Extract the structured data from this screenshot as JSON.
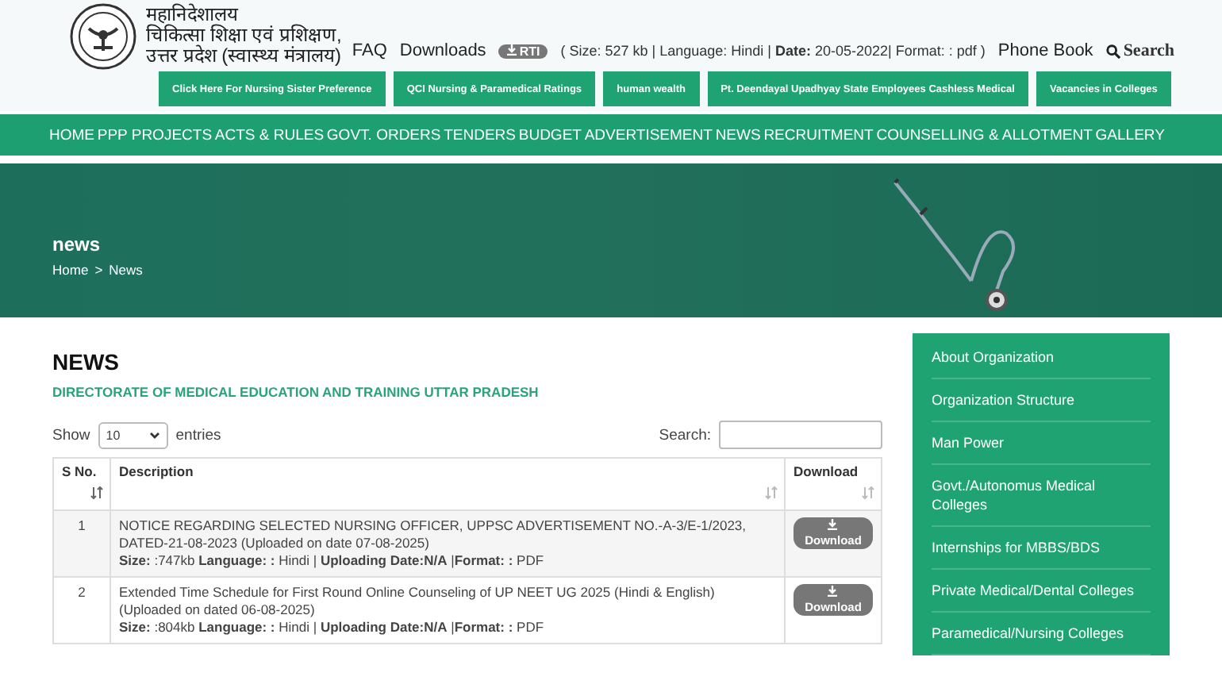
{
  "header": {
    "org_lines": [
      "महानिदेशालय",
      "चिकित्सा शिक्षा एवं प्रशिक्षण,",
      "उत्तर प्रदेश (स्वास्थ्य मंत्रालय)"
    ],
    "top_links": [
      "FAQ",
      "Downloads"
    ],
    "rti_badge": "RTI",
    "rti_info": "( Size: 527 kb | Language: Hindi | **Date:** 20-05-2022| Format: : pdf )",
    "phone_book": "Phone Book",
    "search": "Search"
  },
  "quick_links": [
    "Click Here For Nursing Sister Preference",
    "QCI Nursing & Paramedical Ratings",
    "human wealth",
    "Pt. Deendayal Upadhyay State Employees Cashless Medical",
    "Vacancies in Colleges"
  ],
  "nav": [
    "HOME",
    "PPP PROJECTS",
    "ACTS & RULES",
    "GOVT. ORDERS",
    "TENDERS",
    "BUDGET",
    "ADVERTISEMENT",
    "NEWS",
    "RECRUITMENT",
    "COUNSELLING & ALLOTMENT",
    "GALLERY"
  ],
  "banner": {
    "title": "news",
    "breadcrumb": [
      "Home",
      ">",
      "News"
    ]
  },
  "content": {
    "heading": "NEWS",
    "subheading": "DIRECTORATE OF MEDICAL EDUCATION AND TRAINING UTTAR PRADESH",
    "show_label": "Show",
    "entries_select": "10",
    "entries_label": "entries",
    "search_label": "Search:",
    "table": {
      "columns": [
        "S No.",
        "Description",
        "Download"
      ],
      "rows": [
        {
          "sno": "1",
          "description": "NOTICE REGARDING SELECTED NURSING OFFICER, UPPSC ADVERTISEMENT NO.-A-3/E-1/2023, DATED-21-08-2023 (Uploaded on date 07-08-2025)",
          "meta": "**Size:** :747kb **Language: :** Hindi | **Uploading Date:N/A** |**Format: :** PDF",
          "button": "Download"
        },
        {
          "sno": "2",
          "description": "Extended Time Schedule for First Round Online Counseling of UP NEET UG 2025 (Hindi & English) (Uploaded on dated 06-08-2025)",
          "meta": "**Size:** :804kb **Language: :** Hindi | **Uploading Date:N/A** |**Format: :** PDF",
          "button": "Download"
        }
      ]
    }
  },
  "sidebar": {
    "items": [
      "About Organization",
      "Organization Structure",
      "Man Power",
      "Govt./Autonomus Medical Colleges",
      "Internships for MBBS/BDS",
      "Private Medical/Dental Colleges",
      "Paramedical/Nursing Colleges"
    ]
  }
}
